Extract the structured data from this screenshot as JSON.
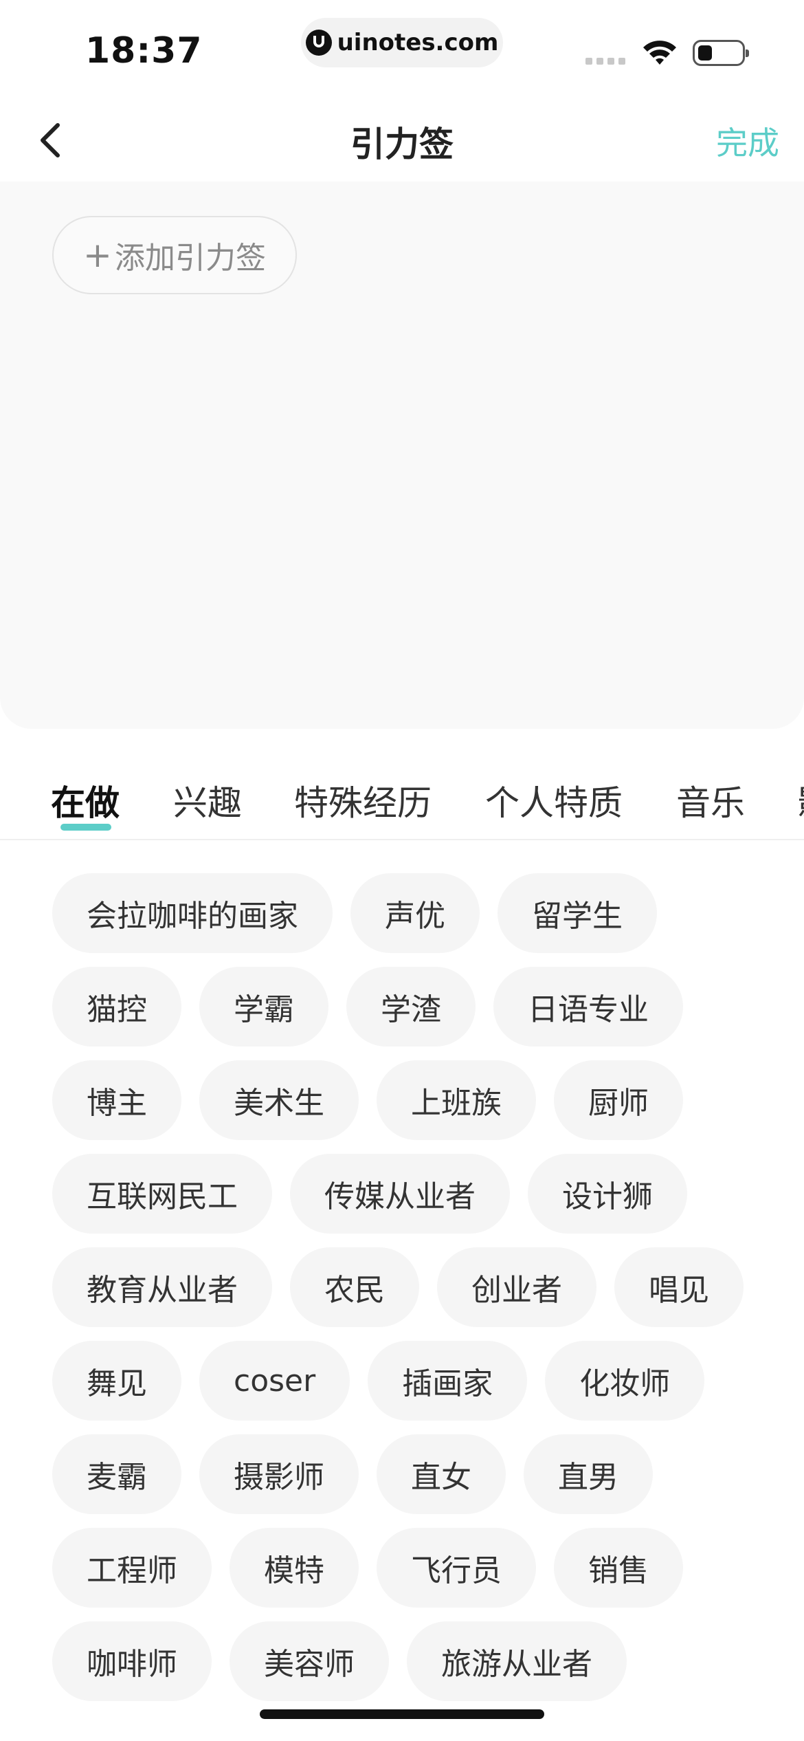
{
  "status_bar": {
    "time": "18:37",
    "url": "uinotes.com"
  },
  "nav": {
    "title": "引力签",
    "done_label": "完成"
  },
  "selected": {
    "add_label": "添加引力签"
  },
  "tabs": [
    {
      "label": "在做",
      "active": true
    },
    {
      "label": "兴趣"
    },
    {
      "label": "特殊经历"
    },
    {
      "label": "个人特质"
    },
    {
      "label": "音乐"
    },
    {
      "label": "影"
    }
  ],
  "tag_rows": [
    [
      "会拉咖啡的画家",
      "声优",
      "留学生"
    ],
    [
      "猫控",
      "学霸",
      "学渣",
      "日语专业"
    ],
    [
      "博主",
      "美术生",
      "上班族",
      "厨师"
    ],
    [
      "互联网民工",
      "传媒从业者",
      "设计狮"
    ],
    [
      "教育从业者",
      "农民",
      "创业者",
      "唱见"
    ],
    [
      "舞见",
      "coser",
      "插画家",
      "化妆师"
    ],
    [
      "麦霸",
      "摄影师",
      "直女",
      "直男"
    ],
    [
      "工程师",
      "模特",
      "飞行员",
      "销售"
    ],
    [
      "咖啡师",
      "美容师",
      "旅游从业者"
    ]
  ],
  "colors": {
    "accent": "#5ccdc8",
    "tag_bg": "#f5f5f5",
    "panel_bg": "#f9f9f9"
  }
}
